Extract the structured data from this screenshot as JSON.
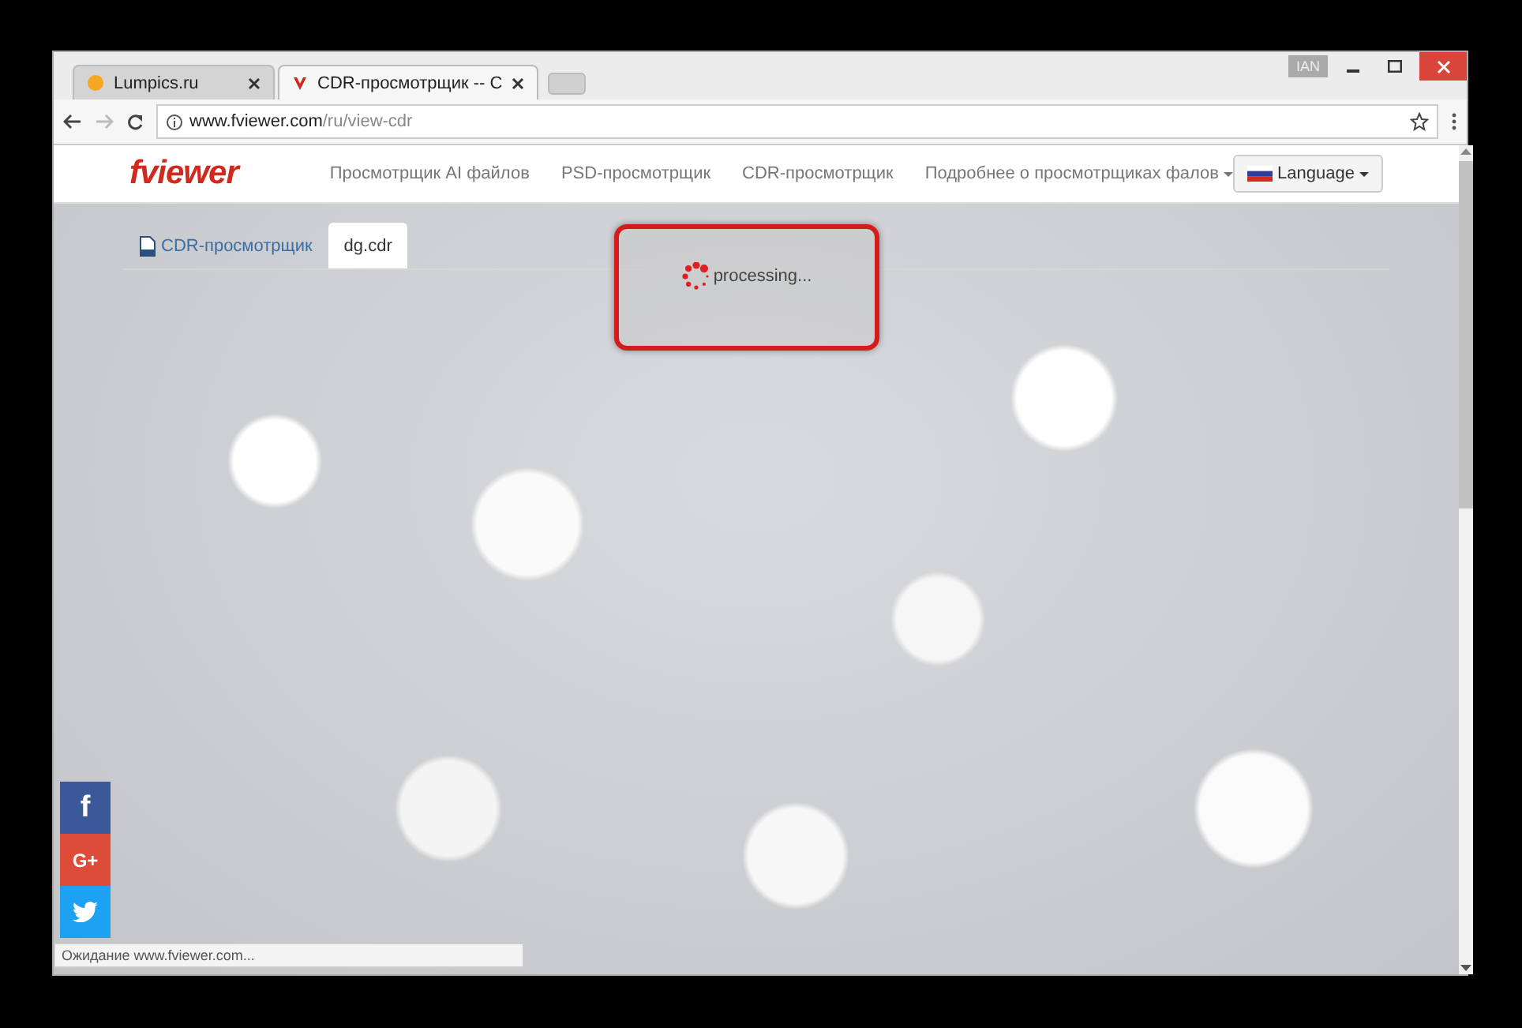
{
  "browser": {
    "tabs": [
      {
        "title": "Lumpics.ru",
        "selected": false
      },
      {
        "title": "CDR-просмотрщик -- С",
        "selected": true
      }
    ],
    "profile_badge": "IAN",
    "address": {
      "host": "www.fviewer.com",
      "path": "/ru/view-cdr"
    }
  },
  "site": {
    "logo": "fviewer",
    "nav": [
      "Просмотрщик AI файлов",
      "PSD-просмотрщик",
      "CDR-просмотрщик",
      "Подробнее о просмотрщиках фалов"
    ],
    "language_button": "Language"
  },
  "page_tabs": [
    {
      "label": "CDR-просмотрщик",
      "kind": "link",
      "selected": false
    },
    {
      "label": "dg.cdr",
      "kind": "file",
      "selected": true
    }
  ],
  "processing": {
    "text": "processing..."
  },
  "social": [
    {
      "kind": "facebook",
      "label": "f"
    },
    {
      "kind": "googleplus",
      "label": "G+"
    },
    {
      "kind": "twitter"
    }
  ],
  "status_bar": "Ожидание www.fviewer.com..."
}
